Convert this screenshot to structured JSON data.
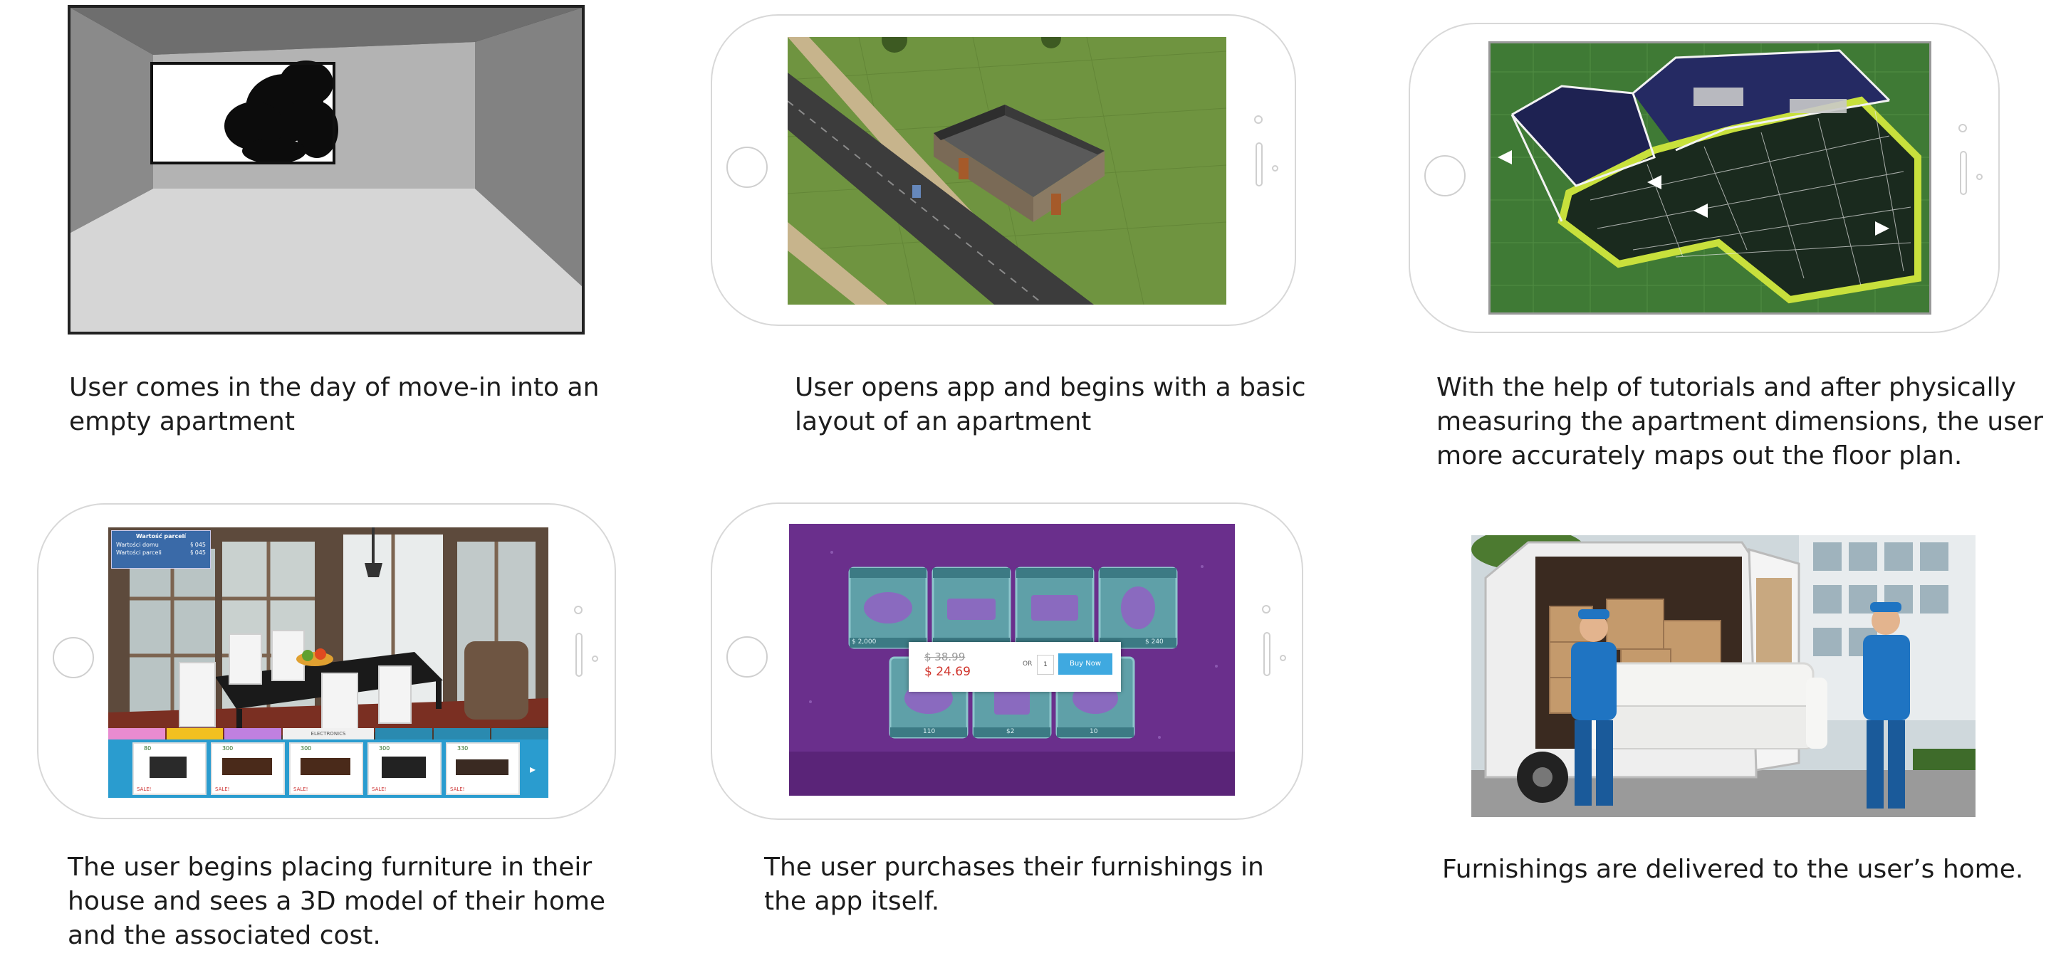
{
  "steps": [
    {
      "caption_lines": [
        "User comes in the day of move-in into an",
        "empty apartment"
      ]
    },
    {
      "caption_lines": [
        "User opens app and begins with a basic",
        "layout of an apartment"
      ]
    },
    {
      "caption_lines": [
        "With the help of tutorials and after physically",
        "measuring the apartment dimensions, the user",
        "more accurately maps out the floor plan."
      ]
    },
    {
      "caption_lines": [
        "The user begins placing furniture in their",
        "house and sees a 3D model of their home",
        "and the associated cost."
      ],
      "screen": {
        "info_title": "Wartość parcelí",
        "info_row1_label": "Wartości domu",
        "info_row1_value": "§ 045",
        "info_row2_label": "Wartości parceli",
        "info_row2_value": "§ 045",
        "tab_active": "ELECTRONICS",
        "item_prices": [
          "80",
          "300",
          "300",
          "300",
          "330"
        ],
        "item_tags": [
          "SALE!",
          "SALE!",
          "SALE!",
          "SALE!",
          "SALE!"
        ]
      }
    },
    {
      "caption_lines": [
        "The user purchases their furnishings in",
        "the app itself."
      ],
      "screen": {
        "old_price": "$ 38.99",
        "new_price": "$ 24.69",
        "or_label": "OR",
        "or_value": "1",
        "buy_label": "Buy Now",
        "top_prices": [
          "$ 2,000",
          "",
          "",
          "$ 240"
        ],
        "bottom_prices": [
          "110",
          "$2",
          "10"
        ]
      }
    },
    {
      "caption_lines": [
        "Furnishings are delivered to the user’s home."
      ]
    }
  ],
  "colors": {
    "phone_outline": "#d8d8d8",
    "grass": "#6b8f3a",
    "store_purple": "#6a2f8c",
    "buy_blue": "#3fa9e0",
    "price_red": "#d0342c",
    "mover_blue": "#1f74c2"
  }
}
